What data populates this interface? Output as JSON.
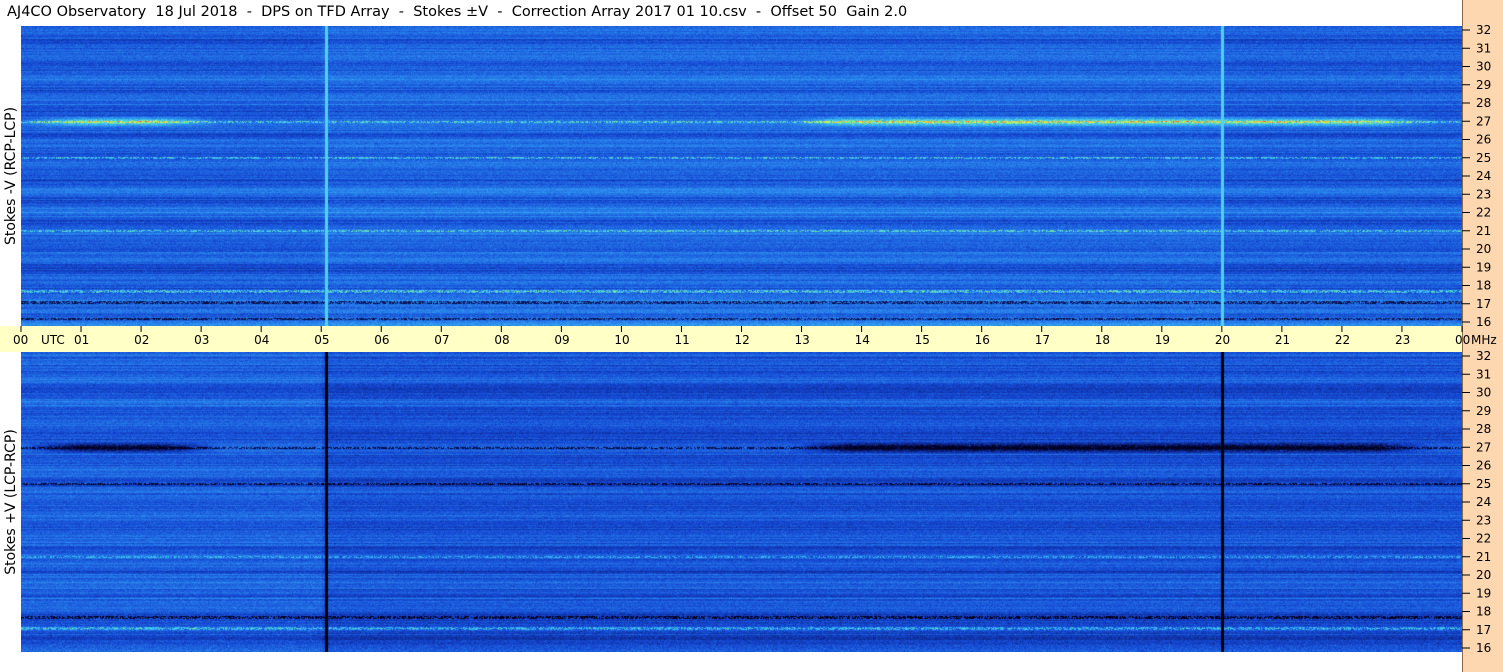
{
  "title": "AJ4CO Observatory  18 Jul 2018  -  DPS on TFD Array  -  Stokes ±V  -  Correction Array 2017 01 10.csv  -  Offset 50  Gain 2.0",
  "chart_data": [
    {
      "type": "heatmap",
      "ylabel": "Stokes -V (RCP-LCP)",
      "x_ticks": [
        "00",
        "01",
        "02",
        "03",
        "04",
        "05",
        "06",
        "07",
        "08",
        "09",
        "10",
        "11",
        "12",
        "13",
        "14",
        "15",
        "16",
        "17",
        "18",
        "19",
        "20",
        "21",
        "22",
        "23",
        "00"
      ],
      "xlim": [
        0,
        24
      ],
      "y_ticks": [
        16,
        17,
        18,
        19,
        20,
        21,
        22,
        23,
        24,
        25,
        26,
        27,
        28,
        29,
        30,
        31,
        32
      ],
      "ylim": [
        16,
        32
      ],
      "palette": [
        "#000020",
        "#0a1a6e",
        "#1446d2",
        "#2a86ee",
        "#3cc8f0",
        "#9af07c",
        "#f0f046",
        "#f05a32"
      ],
      "features": {
        "bright_bands_mhz": [
          27,
          25,
          21,
          17.7
        ],
        "dark_bands_mhz": [
          17.1,
          16.2
        ],
        "vertical_lines_utc": [
          5.08,
          20.0
        ],
        "emission_band": {
          "mhz": 27,
          "utc_ranges": [
            [
              0,
              3.3
            ],
            [
              12.8,
              23.5
            ]
          ]
        }
      }
    },
    {
      "type": "heatmap",
      "ylabel": "Stokes +V (LCP-RCP)",
      "x_ticks": [
        "00",
        "01",
        "02",
        "03",
        "04",
        "05",
        "06",
        "07",
        "08",
        "09",
        "10",
        "11",
        "12",
        "13",
        "14",
        "15",
        "16",
        "17",
        "18",
        "19",
        "20",
        "21",
        "22",
        "23",
        "00"
      ],
      "xlim": [
        0,
        24
      ],
      "y_ticks": [
        16,
        17,
        18,
        19,
        20,
        21,
        22,
        23,
        24,
        25,
        26,
        27,
        28,
        29,
        30,
        31,
        32
      ],
      "ylim": [
        16,
        32
      ],
      "palette": [
        "#000020",
        "#0a1a6e",
        "#1446d2",
        "#2a86ee",
        "#3cc8f0",
        "#9af07c",
        "#f0f046",
        "#f05a32"
      ],
      "features": {
        "dark_bands_mhz": [
          27,
          25,
          17.7
        ],
        "bright_bands_mhz": [
          17.1,
          21
        ],
        "vertical_lines_utc": [
          5.08,
          20.0
        ],
        "emission_band": {
          "mhz": 27,
          "utc_ranges": [
            [
              0,
              3.3
            ],
            [
              12.8,
              23.5
            ]
          ]
        }
      }
    }
  ],
  "axis": {
    "utc_label": "UTC",
    "mhz_label": "MHz"
  }
}
